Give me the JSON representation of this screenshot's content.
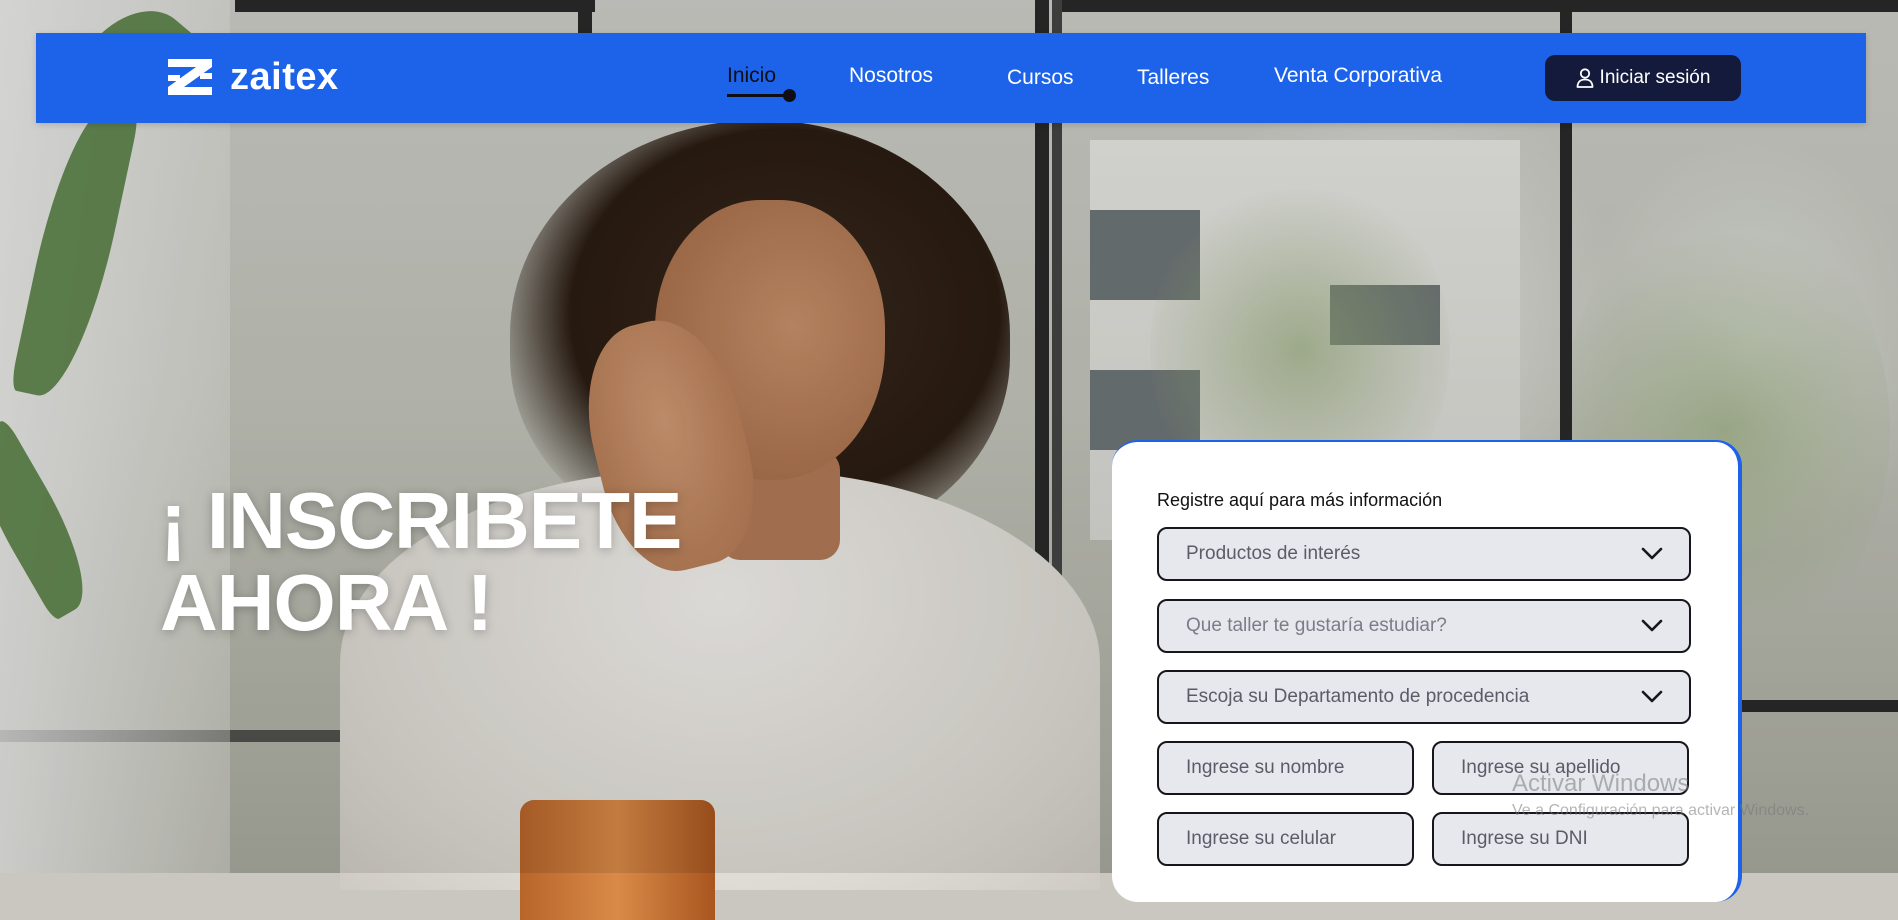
{
  "brand": {
    "name": "zaitex"
  },
  "nav": {
    "items": [
      {
        "label": "Inicio",
        "active": true
      },
      {
        "label": "Nosotros"
      },
      {
        "label": "Cursos"
      },
      {
        "label": "Talleres"
      },
      {
        "label": "Venta Corporativa"
      }
    ],
    "login_label": "Iniciar sesión"
  },
  "hero": {
    "line1": "¡ INSCRIBETE",
    "line2": "AHORA !"
  },
  "form": {
    "title": "Registre aquí para más información",
    "products_placeholder": "Productos de interés",
    "workshop_placeholder": "Que taller te gustaría estudiar?",
    "department_placeholder": "Escoja su Departamento de procedencia",
    "first_name_placeholder": "Ingrese su nombre",
    "last_name_placeholder": "Ingrese su apellido",
    "phone_placeholder": "Ingrese su celular",
    "dni_placeholder": "Ingrese su DNI"
  },
  "watermark": {
    "title": "Activar Windows",
    "subtitle": "Ve a Configuración para activar Windows."
  },
  "colors": {
    "nav_bg": "#1d63ea",
    "login_bg": "#141a3c",
    "field_bg": "#e7e8ee"
  },
  "icons": [
    "zaitex-logo-icon",
    "user-icon",
    "chevron-down-icon"
  ]
}
